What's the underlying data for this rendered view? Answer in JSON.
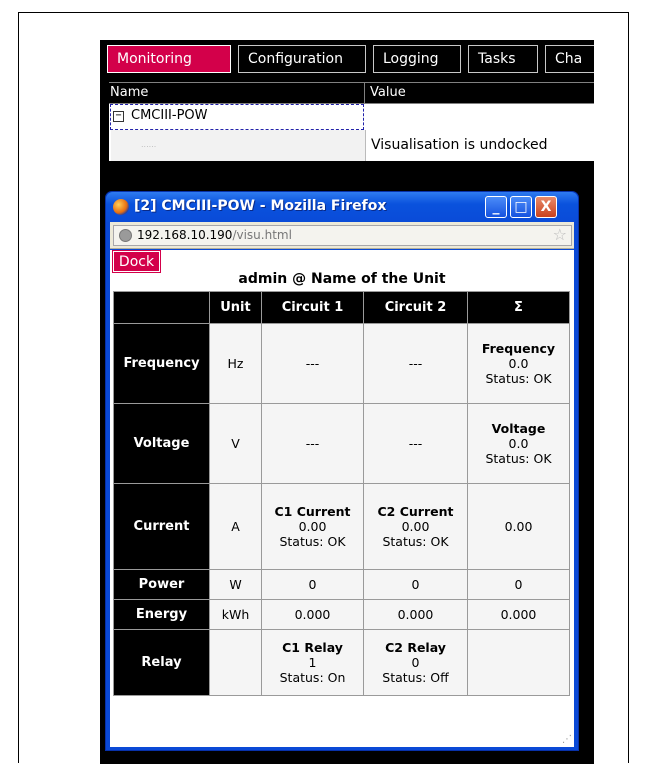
{
  "tabs": [
    {
      "label": "Monitoring",
      "active": true
    },
    {
      "label": "Configuration",
      "active": false
    },
    {
      "label": "Logging",
      "active": false
    },
    {
      "label": "Tasks",
      "active": false
    },
    {
      "label": "Cha",
      "active": false
    }
  ],
  "tree": {
    "col_name": "Name",
    "col_value": "Value",
    "node_label": "CMCIII-POW",
    "node_expander": "−",
    "child_dots": "......",
    "child_value": "Visualisation is undocked"
  },
  "popup": {
    "title": "[2] CMCIII-POW - Mozilla Firefox",
    "url_host": "192.168.10.190",
    "url_path": "/visu.html",
    "btn_minimize": "_",
    "btn_maximize": "□",
    "btn_close": "X",
    "dock_label": "Dock",
    "heading": "admin @ Name of the Unit"
  },
  "visu_table": {
    "headers": [
      "",
      "Unit",
      "Circuit 1",
      "Circuit 2",
      "Σ"
    ],
    "rows": [
      {
        "name": "Frequency",
        "unit": "Hz",
        "c1": [
          "",
          "---",
          ""
        ],
        "c2": [
          "",
          "---",
          ""
        ],
        "sum": [
          "Frequency",
          "0.0",
          "Status: OK"
        ]
      },
      {
        "name": "Voltage",
        "unit": "V",
        "c1": [
          "",
          "---",
          ""
        ],
        "c2": [
          "",
          "---",
          ""
        ],
        "sum": [
          "Voltage",
          "0.0",
          "Status: OK"
        ]
      },
      {
        "name": "Current",
        "unit": "A",
        "c1": [
          "C1 Current",
          "0.00",
          "Status: OK"
        ],
        "c2": [
          "C2 Current",
          "0.00",
          "Status: OK"
        ],
        "sum": [
          "",
          "0.00",
          ""
        ]
      },
      {
        "name": "Power",
        "unit": "W",
        "c1": [
          "",
          "0",
          ""
        ],
        "c2": [
          "",
          "0",
          ""
        ],
        "sum": [
          "",
          "0",
          ""
        ]
      },
      {
        "name": "Energy",
        "unit": "kWh",
        "c1": [
          "",
          "0.000",
          ""
        ],
        "c2": [
          "",
          "0.000",
          ""
        ],
        "sum": [
          "",
          "0.000",
          ""
        ]
      },
      {
        "name": "Relay",
        "unit": "",
        "c1": [
          "C1 Relay",
          "1",
          "Status: On"
        ],
        "c2": [
          "C2 Relay",
          "0",
          "Status: Off"
        ],
        "sum": [
          "",
          "",
          ""
        ]
      }
    ]
  },
  "colors": {
    "accent": "#d3004a",
    "xp_title_blue": "#0a52dd",
    "app_background": "#000000"
  }
}
